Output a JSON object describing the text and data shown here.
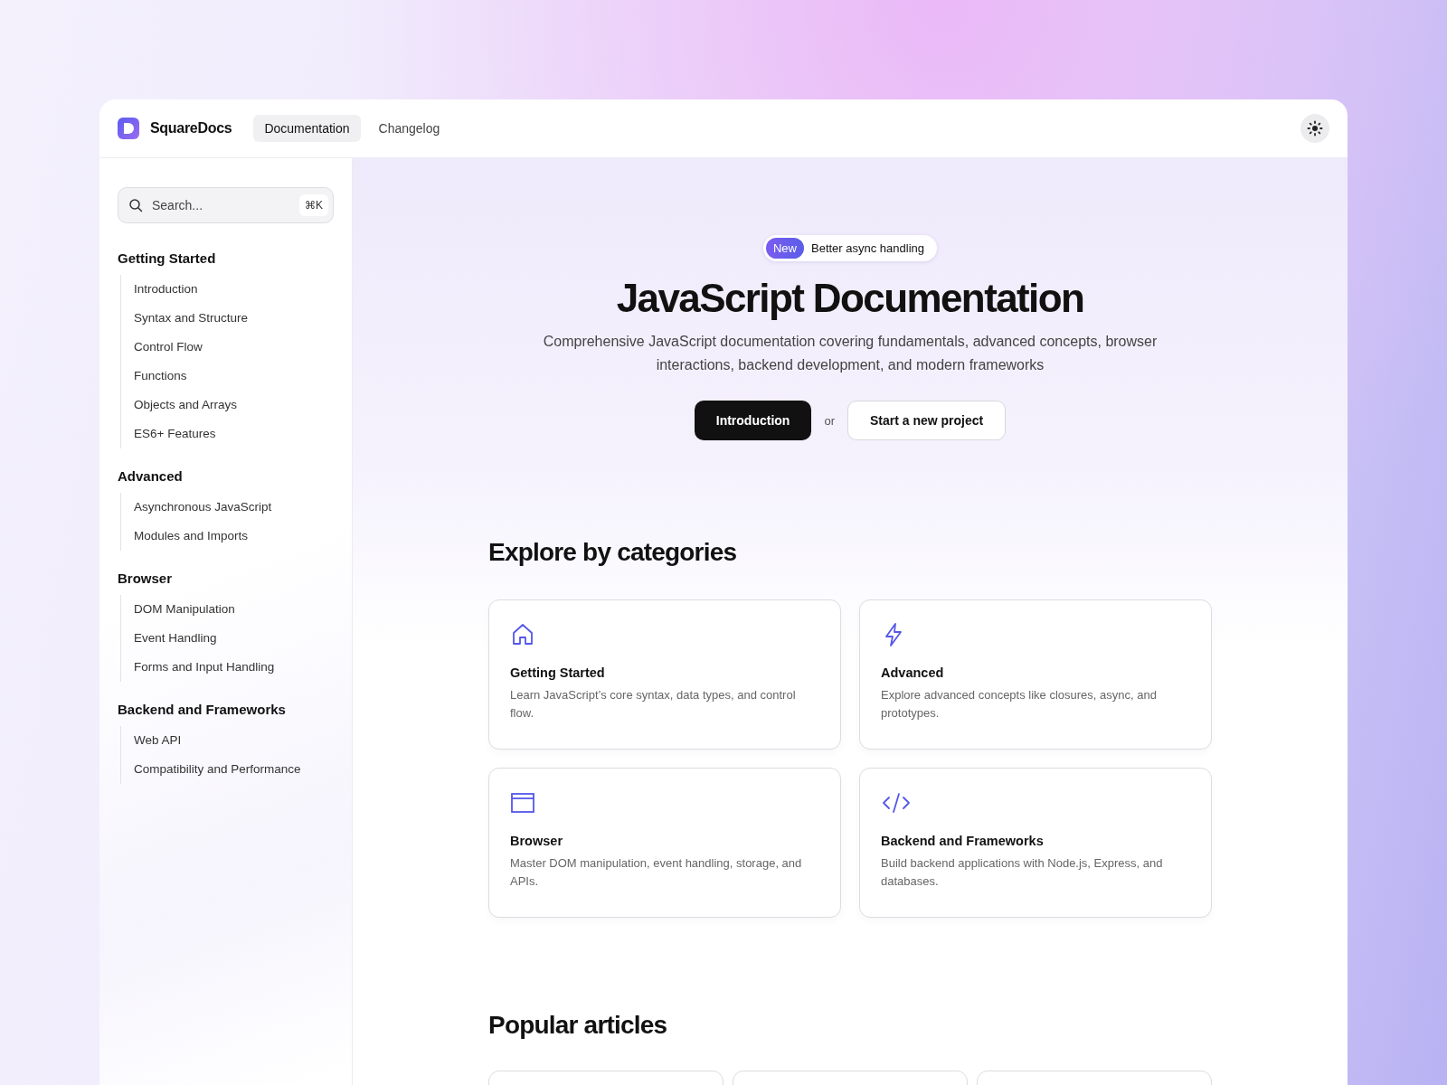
{
  "header": {
    "brand": "SquareDocs",
    "nav": [
      {
        "label": "Documentation",
        "selected": true
      },
      {
        "label": "Changelog",
        "selected": false
      }
    ]
  },
  "sidebar": {
    "search": {
      "placeholder": "Search...",
      "shortcut": "⌘K"
    },
    "sections": [
      {
        "title": "Getting Started",
        "items": [
          "Introduction",
          "Syntax and Structure",
          "Control Flow",
          "Functions",
          "Objects and Arrays",
          "ES6+ Features"
        ]
      },
      {
        "title": "Advanced",
        "items": [
          "Asynchronous JavaScript",
          "Modules and Imports"
        ]
      },
      {
        "title": "Browser",
        "items": [
          "DOM Manipulation",
          "Event Handling",
          "Forms and Input Handling"
        ]
      },
      {
        "title": "Backend and Frameworks",
        "items": [
          "Web API",
          "Compatibility and Performance"
        ]
      }
    ]
  },
  "hero": {
    "badge": {
      "tag": "New",
      "text": "Better async handling"
    },
    "title": "JavaScript Documentation",
    "subtitle": "Comprehensive JavaScript documentation covering fundamentals, advanced concepts, browser interactions, backend development, and modern frameworks",
    "primary_button": "Introduction",
    "separator": "or",
    "secondary_button": "Start a new project"
  },
  "categories": {
    "heading": "Explore by categories",
    "cards": [
      {
        "kind": "home",
        "title": "Getting Started",
        "description": "Learn JavaScript’s core syntax, data types, and control flow."
      },
      {
        "kind": "bolt",
        "title": "Advanced",
        "description": "Explore advanced concepts like closures, async, and prototypes."
      },
      {
        "kind": "window",
        "title": "Browser",
        "description": "Master DOM manipulation, event handling, storage, and APIs."
      },
      {
        "kind": "code",
        "title": "Backend and Frameworks",
        "description": "Build backend applications with Node.js, Express, and databases."
      }
    ]
  },
  "popular": {
    "heading": "Popular articles"
  }
}
